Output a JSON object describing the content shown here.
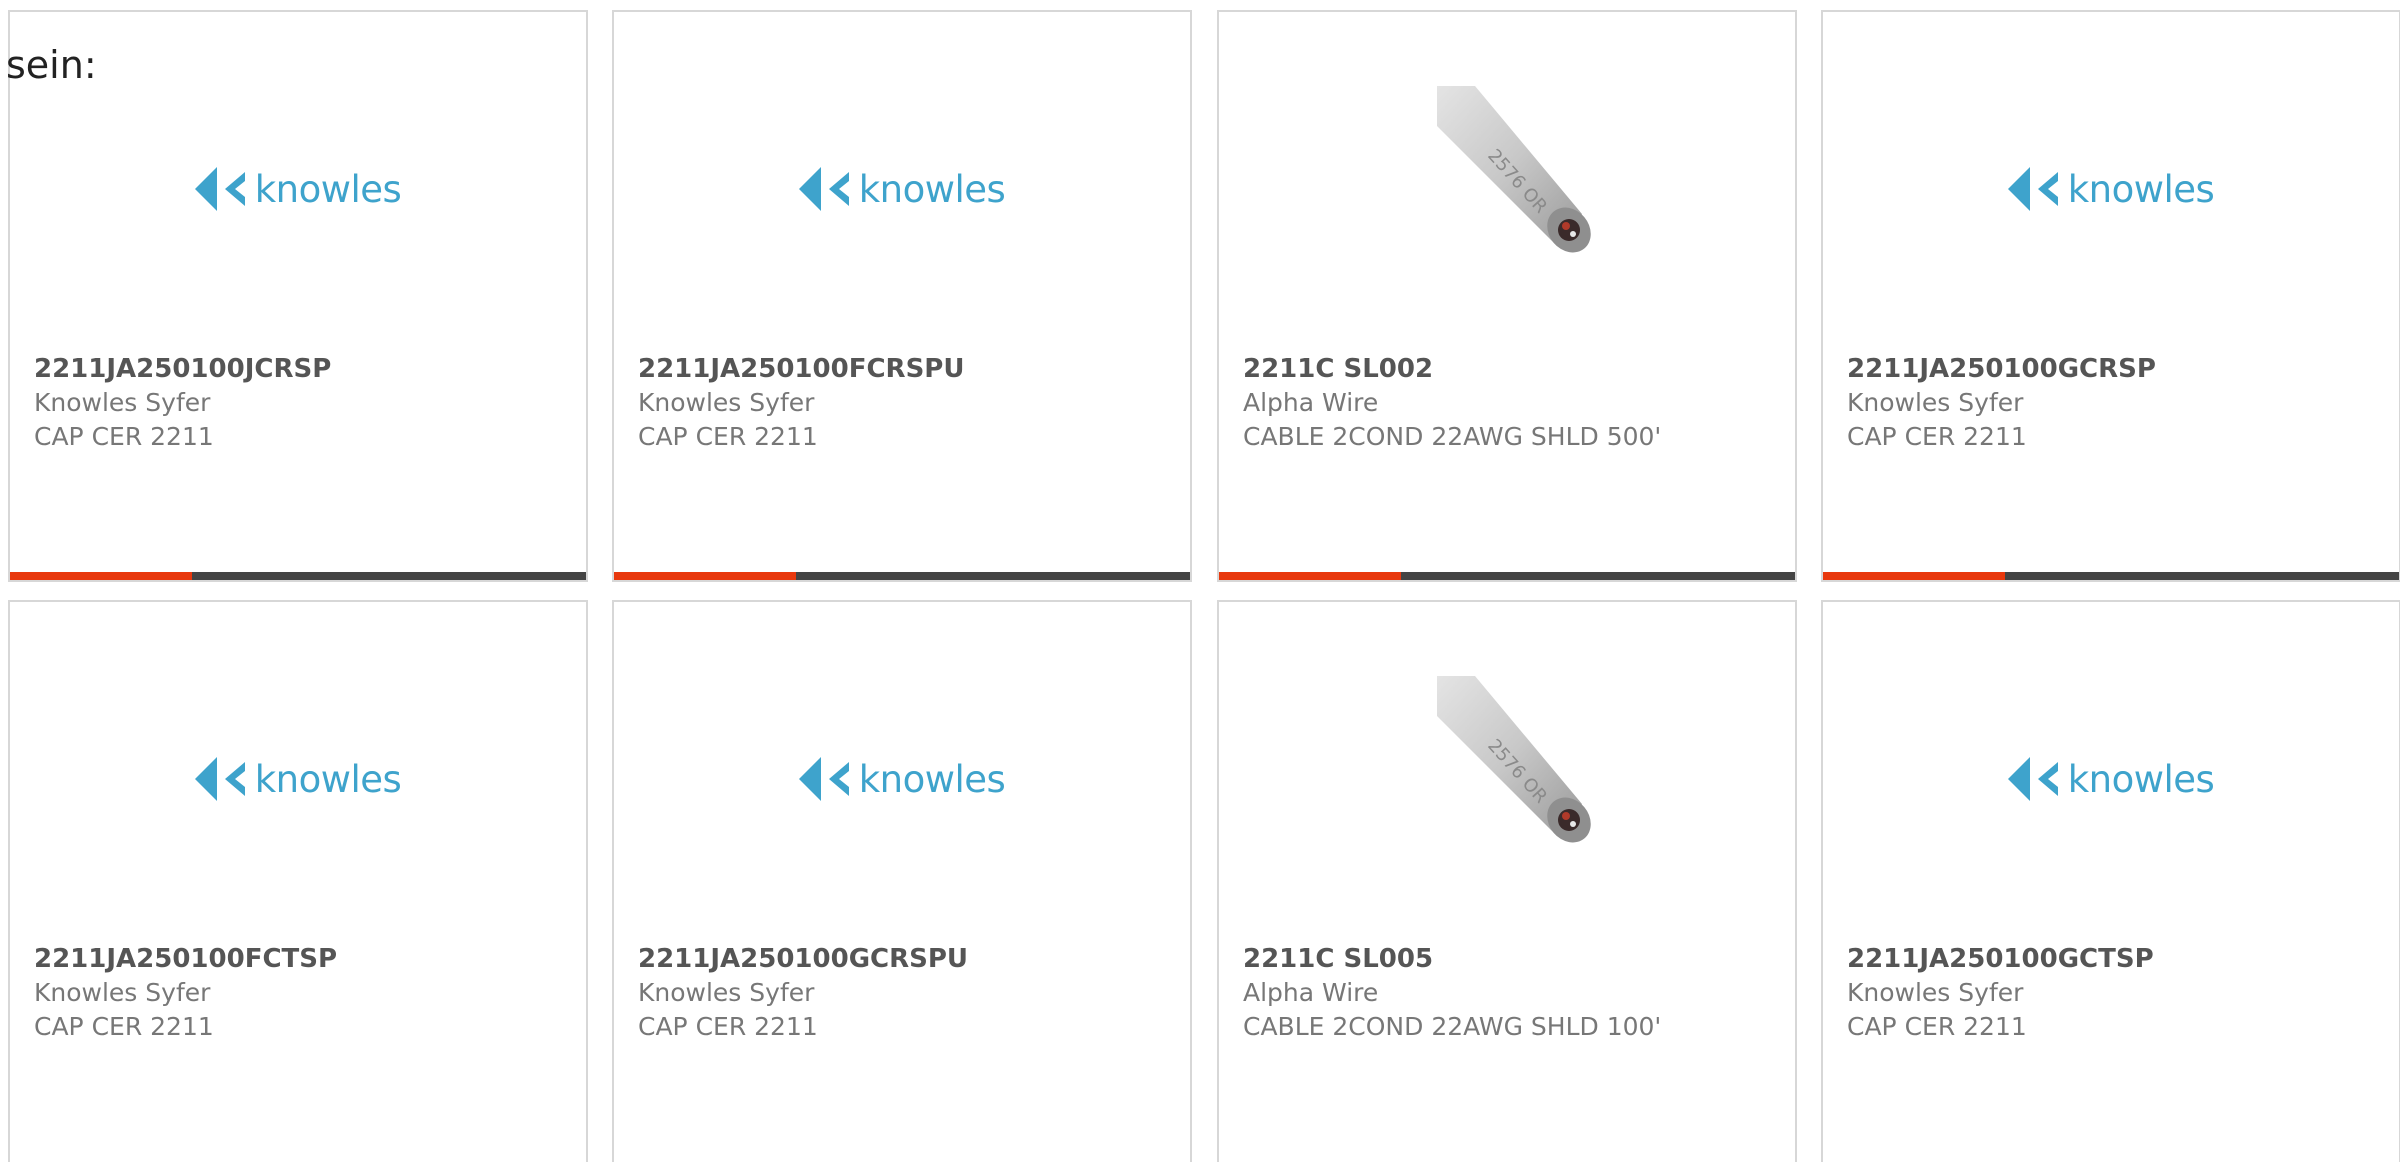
{
  "fragment_text": "sein:",
  "colors": {
    "accent": "#e8380d",
    "bar": "#444444",
    "knowles_blue": "#3ea3cc",
    "card_border": "#d7d7d7"
  },
  "products": [
    {
      "part_number": "2211JA250100JCRSP",
      "manufacturer": "Knowles Syfer",
      "description": "CAP CER 2211",
      "image": "knowles-logo",
      "logo_text": "knowles"
    },
    {
      "part_number": "2211JA250100FCRSPU",
      "manufacturer": "Knowles Syfer",
      "description": "CAP CER 2211",
      "image": "knowles-logo",
      "logo_text": "knowles"
    },
    {
      "part_number": "2211C SL002",
      "manufacturer": "Alpha Wire",
      "description": "CABLE 2COND 22AWG SHLD 500'",
      "image": "cable-photo",
      "logo_text": ""
    },
    {
      "part_number": "2211JA250100GCRSP",
      "manufacturer": "Knowles Syfer",
      "description": "CAP CER 2211",
      "image": "knowles-logo",
      "logo_text": "knowles"
    },
    {
      "part_number": "2211JA250100FCTSP",
      "manufacturer": "Knowles Syfer",
      "description": "CAP CER 2211",
      "image": "knowles-logo",
      "logo_text": "knowles"
    },
    {
      "part_number": "2211JA250100GCRSPU",
      "manufacturer": "Knowles Syfer",
      "description": "CAP CER 2211",
      "image": "knowles-logo",
      "logo_text": "knowles"
    },
    {
      "part_number": "2211C SL005",
      "manufacturer": "Alpha Wire",
      "description": "CABLE 2COND 22AWG SHLD 100'",
      "image": "cable-photo",
      "logo_text": ""
    },
    {
      "part_number": "2211JA250100GCTSP",
      "manufacturer": "Knowles Syfer",
      "description": "CAP CER 2211",
      "image": "knowles-logo",
      "logo_text": "knowles"
    }
  ]
}
